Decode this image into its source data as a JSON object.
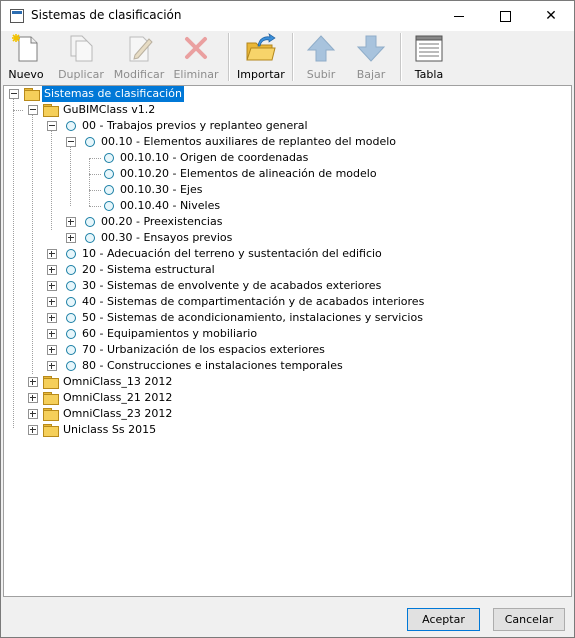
{
  "window": {
    "title": "Sistemas de clasificación",
    "icon": "window-app-icon",
    "controls": [
      "minimize-icon",
      "maximize-icon",
      "close-icon"
    ]
  },
  "toolbar": {
    "nuevo": "Nuevo",
    "duplicar": "Duplicar",
    "modificar": "Modificar",
    "eliminar": "Eliminar",
    "importar": "Importar",
    "subir": "Subir",
    "bajar": "Bajar",
    "tabla": "Tabla",
    "disabled": [
      "Duplicar",
      "Modificar",
      "Eliminar",
      "Subir",
      "Bajar"
    ]
  },
  "tree": {
    "root": "Sistemas de clasificación",
    "gubim": "GuBIMClass v1.2",
    "n00": "00 - Trabajos previos y replanteo general",
    "n0010": "00.10 - Elementos auxiliares de replanteo del modelo",
    "n001010": "00.10.10 - Origen de coordenadas",
    "n001020": "00.10.20 - Elementos de alineación de modelo",
    "n001030": "00.10.30 - Ejes",
    "n001040": "00.10.40 - Niveles",
    "n0020": "00.20 - Preexistencias",
    "n0030": "00.30 - Ensayos previos",
    "n10": "10 - Adecuación del terreno y sustentación del edificio",
    "n20": "20 - Sistema estructural",
    "n30": "30 - Sistemas de envolvente y de acabados exteriores",
    "n40": "40 - Sistemas de compartimentación y de acabados interiores",
    "n50": "50 - Sistemas de acondicionamiento, instalaciones y servicios",
    "n60": "60 - Equipamientos y mobiliario",
    "n70": "70 - Urbanización de los espacios exteriores",
    "n80": "80 - Construcciones e instalaciones temporales",
    "omni13": "OmniClass_13 2012",
    "omni21": "OmniClass_21 2012",
    "omni23": "OmniClass_23 2012",
    "uniclass": "Uniclass Ss 2015",
    "selected": "Sistemas de clasificación"
  },
  "buttons": {
    "accept": "Aceptar",
    "cancel": "Cancelar"
  },
  "colors": {
    "selection": "#0078d7",
    "folder": "#f5cf5a",
    "node_circle": "#1b7fa5"
  }
}
